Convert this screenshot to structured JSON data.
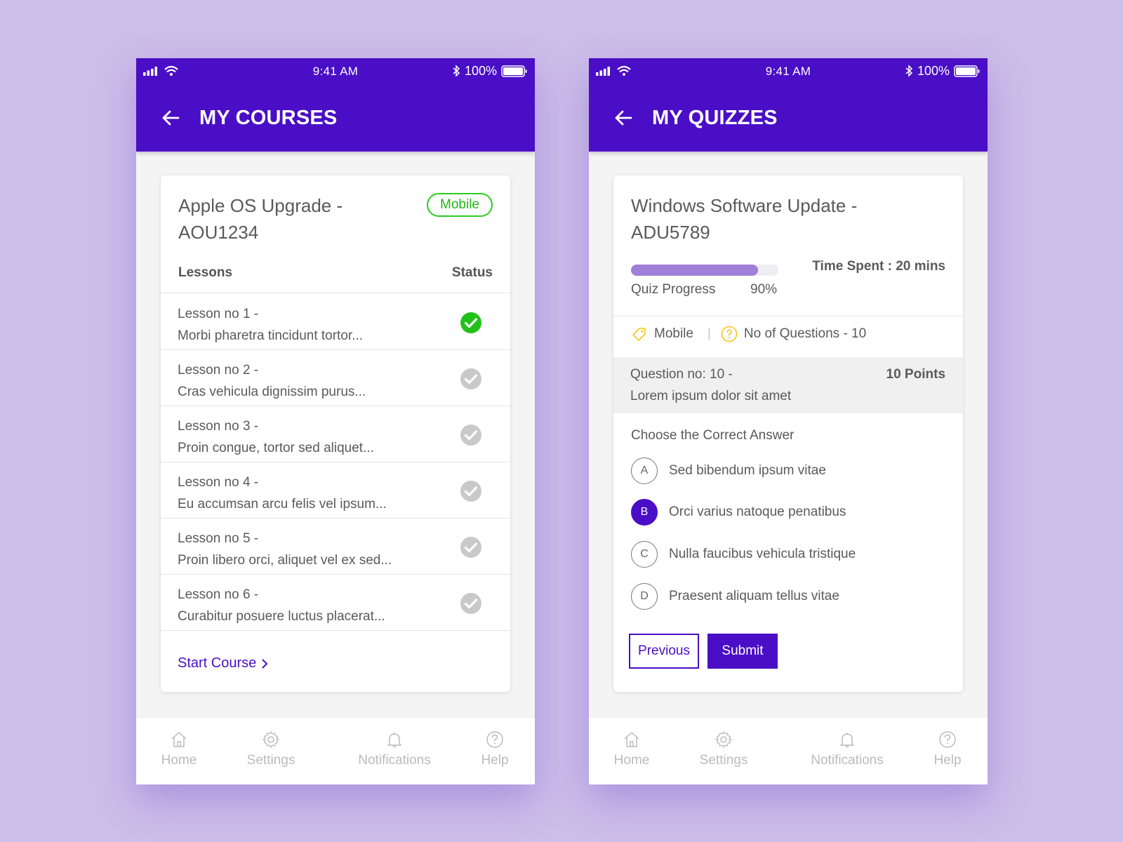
{
  "status_bar": {
    "time": "9:41 AM",
    "battery": "100%"
  },
  "courses_screen": {
    "title": "MY COURSES",
    "course_title": "Apple OS Upgrade - AOU1234",
    "badge": "Mobile",
    "lessons_header": "Lessons",
    "status_header": "Status",
    "lessons": [
      {
        "title": "Lesson no 1 -",
        "desc": "Morbi pharetra tincidunt tortor...",
        "status": "completed"
      },
      {
        "title": "Lesson no 2 -",
        "desc": "Cras vehicula dignissim purus...",
        "status": "pending"
      },
      {
        "title": "Lesson no 3 -",
        "desc": "Proin congue, tortor sed aliquet...",
        "status": "pending"
      },
      {
        "title": "Lesson no 4 -",
        "desc": "Eu accumsan arcu felis vel ipsum...",
        "status": "pending"
      },
      {
        "title": "Lesson no 5 -",
        "desc": "Proin libero orci, aliquet vel ex sed...",
        "status": "pending"
      },
      {
        "title": "Lesson no 6 -",
        "desc": "Curabitur posuere luctus placerat...",
        "status": "pending"
      }
    ],
    "start_course": "Start Course"
  },
  "quizzes_screen": {
    "title": "MY QUIZZES",
    "quiz_title": "Windows Software Update - ADU5789",
    "progress_fraction": 0.86,
    "time_spent": "Time Spent : 20 mins",
    "progress_label": "Quiz Progress",
    "progress_value": "90%",
    "category": "Mobile",
    "questions_count": "No of Questions - 10",
    "question_no": "Question no: 10 -",
    "question_text": "Lorem ipsum dolor sit amet",
    "points": "10 Points",
    "choose_label": "Choose the Correct Answer",
    "options": [
      {
        "letter": "A",
        "text": "Sed bibendum ipsum vitae",
        "selected": false
      },
      {
        "letter": "B",
        "text": "Orci varius natoque penatibus",
        "selected": true
      },
      {
        "letter": "C",
        "text": "Nulla faucibus vehicula tristique",
        "selected": false
      },
      {
        "letter": "D",
        "text": "Praesent aliquam tellus vitae",
        "selected": false
      }
    ],
    "previous_label": "Previous",
    "submit_label": "Submit"
  },
  "tabbar": {
    "home": "Home",
    "settings": "Settings",
    "notifications": "Notifications",
    "help": "Help"
  },
  "colors": {
    "primary": "#4a0ec6",
    "background": "#cdbde9",
    "success": "#22c11a",
    "inactive_check": "#c9c9c9",
    "progress": "#a07fd9",
    "accent_yellow": "#f5c518"
  },
  "icons": {
    "back": "arrow-left-icon",
    "completed": "check-circle-icon",
    "pending": "check-circle-gray-icon",
    "tag": "tag-icon",
    "question": "question-circle-icon"
  }
}
